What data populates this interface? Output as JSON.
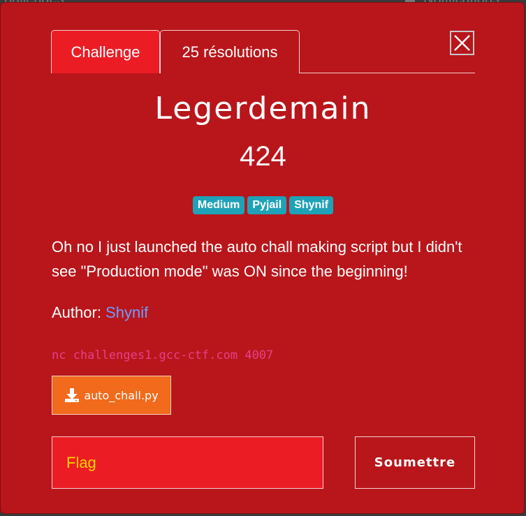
{
  "background": {
    "left_text": "hallenges",
    "right_text": "Notifications"
  },
  "tabs": [
    {
      "label": "Challenge"
    },
    {
      "label": "25 résolutions"
    }
  ],
  "challenge": {
    "name": "Legerdemain",
    "points": "424",
    "tags": [
      "Medium",
      "Pyjail",
      "Shynif"
    ],
    "description": "Oh no I just launched the auto chall making script but I didn't see \"Production mode\" was ON since the beginning!",
    "author_label": "Author: ",
    "author_name": "Shynif",
    "connection": "nc challenges1.gcc-ctf.com 4007",
    "file_name": "auto_chall.py"
  },
  "form": {
    "flag_placeholder": "Flag",
    "submit_label": "Soumettre"
  },
  "icons": {
    "close": "close-icon",
    "download": "download-icon"
  },
  "colors": {
    "modal_bg": "#b8161b",
    "active_tab": "#ec1c24",
    "tag_bg": "#1fa2b7",
    "file_btn": "#f26a1b",
    "flag_text": "#ffd400",
    "author_link": "#6f9cff",
    "connection_text": "#e6408a"
  }
}
